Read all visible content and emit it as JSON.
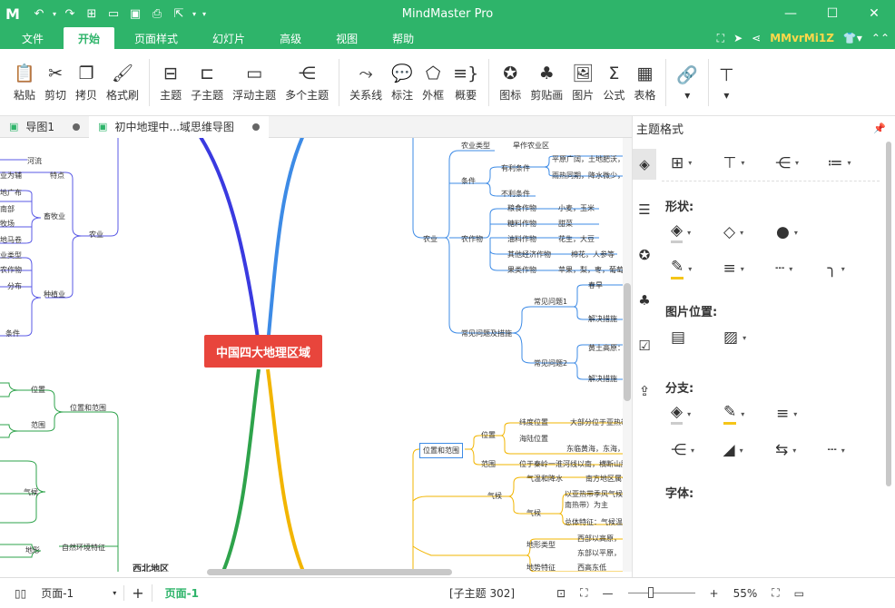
{
  "app": {
    "title": "MindMaster Pro",
    "user": "MMvrMi1Z",
    "brand_color": "#2eb46a"
  },
  "menu": {
    "tabs": [
      "文件",
      "开始",
      "页面样式",
      "幻灯片",
      "高级",
      "视图",
      "帮助"
    ],
    "active": "开始"
  },
  "ribbon": {
    "buttons": [
      "粘贴",
      "剪切",
      "拷贝",
      "格式刷",
      "主题",
      "子主题",
      "浮动主题",
      "多个主题",
      "关系线",
      "标注",
      "外框",
      "概要",
      "图标",
      "剪贴画",
      "图片",
      "公式",
      "表格"
    ]
  },
  "doc_tabs": [
    "导图1",
    "初中地理中...域思维导图"
  ],
  "map": {
    "root": "中国四大地理区域",
    "left": {
      "n0": "河流",
      "n1": "业为辅",
      "n2": "特点",
      "n3": "地广布",
      "n4": "南部",
      "n5": "牧场",
      "n6": "畜牧业",
      "n7": "地马卷",
      "n8": "农业",
      "n9": "业类型",
      "n10": "农作物",
      "n11": "分布",
      "n12": "种植业",
      "n13": "条件",
      "n14": "位置",
      "n15": "范围",
      "n16": "位置和范围",
      "n17": "气候",
      "n18": "地形",
      "n19": "自然环境特征",
      "n20": "西北地区"
    },
    "right": {
      "r0": "农业类型",
      "r1": "旱作农业区",
      "r2": "条件",
      "r3": "有利条件",
      "r4": "平原广阔，土地肥沃，",
      "r5": "雨热同期，降水微少，",
      "r6": "不利条件",
      "r7": "农业",
      "r8": "农作物",
      "r9": "粮食作物",
      "r10": "小麦，玉米",
      "r11": "糖料作物",
      "r12": "甜菜",
      "r13": "油料作物",
      "r14": "花生，大豆",
      "r15": "其他经济作物",
      "r16": "棉花，人参等",
      "r17": "果类作物",
      "r18": "苹果，梨，枣，葡萄等",
      "r19": "常见问题1",
      "r20": "春旱",
      "r21": "解决措施",
      "r22": "常见问题及措施",
      "r23": "常见问题2",
      "r24": "黄土高原：",
      "r25": "解决措施",
      "r26": "位置和范围",
      "r27": "位置",
      "r28": "纬度位置",
      "r29": "大部分位于亚热带",
      "r30": "海陆位置",
      "r31": "东临黄海，东海，",
      "r32": "范围",
      "r33": "位于秦岭一淮河线以南，横断山脉以",
      "r34": "气温和降水",
      "r35": "南方地区属于",
      "r36": "气候",
      "r37": "以亚热带季风气候",
      "r38": "南热带）为主",
      "r39": "气候",
      "r40": "总体特征：气候温暖",
      "r41": "地形类型",
      "r42": "西部以高原，",
      "r43": "东部以平原，",
      "r44": "地势特征",
      "r45": "西高东低"
    }
  },
  "panel": {
    "title": "主题格式",
    "sections": {
      "shape": "形状:",
      "image_pos": "图片位置:",
      "branch": "分支:",
      "font": "字体:"
    }
  },
  "status": {
    "page_select": "页面-1",
    "page_tab": "页面-1",
    "topic_count": "[子主题 302]",
    "zoom": "55%"
  }
}
